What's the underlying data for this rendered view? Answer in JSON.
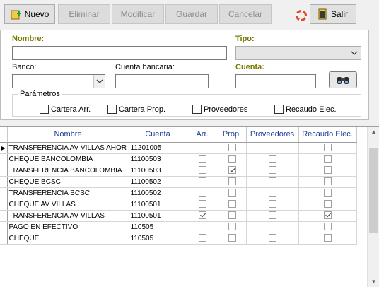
{
  "toolbar": {
    "nuevo": {
      "pre": "",
      "u": "N",
      "post": "uevo"
    },
    "eliminar": {
      "pre": "",
      "u": "E",
      "post": "liminar"
    },
    "modificar": {
      "pre": "",
      "u": "M",
      "post": "odificar"
    },
    "guardar": {
      "pre": "",
      "u": "G",
      "post": "uardar"
    },
    "cancelar": {
      "pre": "",
      "u": "C",
      "post": "ancelar"
    },
    "salir": {
      "pre": "Sal",
      "u": "i",
      "post": "r"
    }
  },
  "form": {
    "nombre_label": "Nombre:",
    "nombre_value": "",
    "tipo_label": "Tipo:",
    "tipo_value": "",
    "banco_label": "Banco:",
    "banco_value": "",
    "cuenta_bancaria_label": "Cuenta bancaria:",
    "cuenta_bancaria_value": "",
    "cuenta_label": "Cuenta:",
    "cuenta_value": ""
  },
  "params": {
    "title": "Parámetros",
    "items": [
      {
        "label": "Cartera Arr."
      },
      {
        "label": "Cartera Prop."
      },
      {
        "label": "Proveedores"
      },
      {
        "label": "Recaudo Elec."
      }
    ]
  },
  "grid": {
    "columns": [
      "Nombre",
      "Cuenta",
      "Arr.",
      "Prop.",
      "Proveedores",
      "Recaudo Elec."
    ],
    "rows": [
      {
        "nombre": "TRANSFERENCIA  AV VILLAS AHOR",
        "cuenta": "11201005",
        "arr": false,
        "prop": false,
        "prov": false,
        "rec": false,
        "current": true
      },
      {
        "nombre": "CHEQUE BANCOLOMBIA",
        "cuenta": "11100503",
        "arr": false,
        "prop": false,
        "prov": false,
        "rec": false
      },
      {
        "nombre": "TRANSFERENCIA BANCOLOMBIA",
        "cuenta": "11100503",
        "arr": false,
        "prop": true,
        "prov": false,
        "rec": false
      },
      {
        "nombre": "CHEQUE BCSC",
        "cuenta": "11100502",
        "arr": false,
        "prop": false,
        "prov": false,
        "rec": false
      },
      {
        "nombre": "TRANSFERENCIA BCSC",
        "cuenta": "11100502",
        "arr": false,
        "prop": false,
        "prov": false,
        "rec": false
      },
      {
        "nombre": "CHEQUE AV VILLAS",
        "cuenta": "11100501",
        "arr": false,
        "prop": false,
        "prov": false,
        "rec": false
      },
      {
        "nombre": "TRANSFERENCIA AV VILLAS",
        "cuenta": "11100501",
        "arr": true,
        "prop": false,
        "prov": false,
        "rec": true
      },
      {
        "nombre": "PAGO EN EFECTIVO",
        "cuenta": "110505",
        "arr": false,
        "prop": false,
        "prov": false,
        "rec": false
      },
      {
        "nombre": "CHEQUE",
        "cuenta": "110505",
        "arr": false,
        "prop": false,
        "prov": false,
        "rec": false
      }
    ]
  },
  "colors": {
    "label_required": "#7a7a00",
    "header_text": "#1f3d99"
  }
}
